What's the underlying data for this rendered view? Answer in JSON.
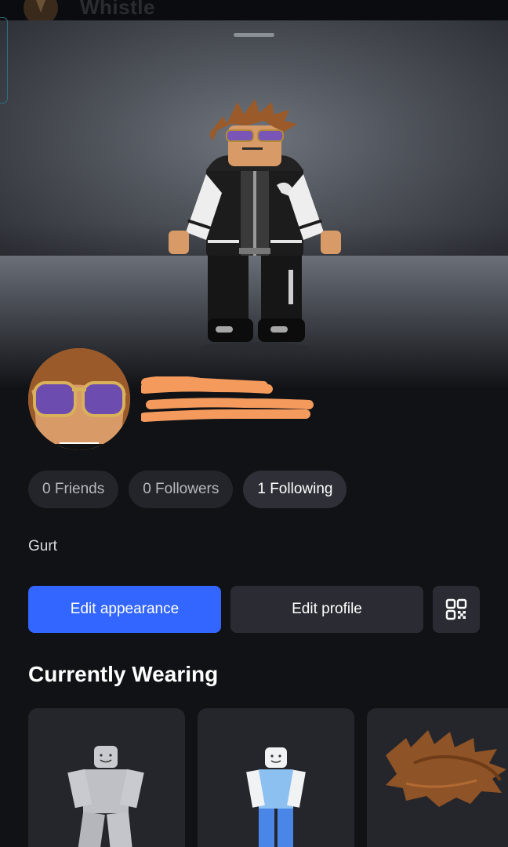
{
  "topbar": {
    "title": "Whistle"
  },
  "profile": {
    "bio": "Gurt"
  },
  "stats": [
    {
      "label": "0 Friends"
    },
    {
      "label": "0 Followers"
    },
    {
      "label": "1 Following"
    }
  ],
  "actions": {
    "edit_appearance": "Edit appearance",
    "edit_profile": "Edit profile",
    "qr_icon": "qr-code-icon"
  },
  "currently_wearing": {
    "title": "Currently Wearing",
    "items": [
      {
        "icon": "gray-body-item-icon"
      },
      {
        "icon": "blue-body-item-icon"
      },
      {
        "icon": "brown-hair-item-icon"
      }
    ]
  },
  "colors": {
    "accent": "#3366ff",
    "background": "#111216",
    "pill": "#24252b",
    "redaction": "#f39a5c"
  }
}
